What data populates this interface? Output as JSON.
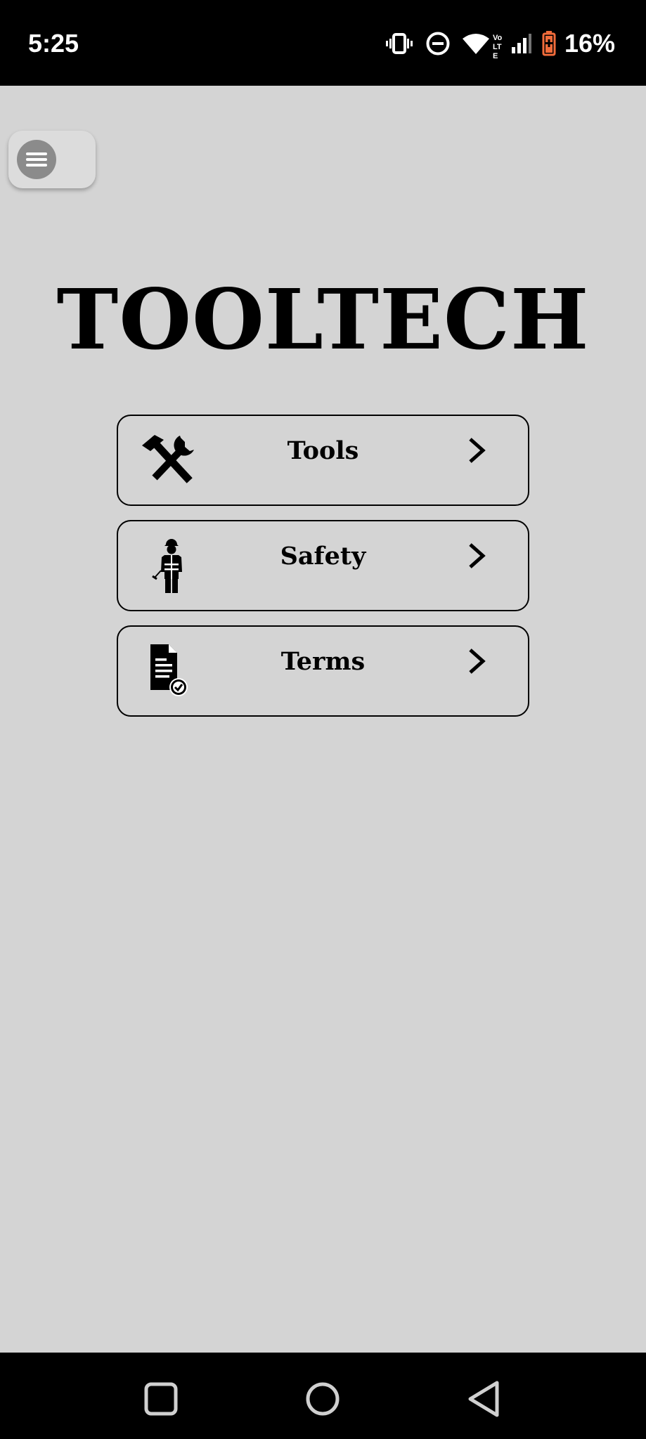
{
  "status_bar": {
    "time": "5:25",
    "battery_percent": "16%",
    "network_label": "Vo LTE",
    "icons": [
      "vibrate-icon",
      "do-not-disturb-icon",
      "wifi-icon",
      "volte-icon",
      "signal-icon",
      "battery-low-icon"
    ],
    "battery_color": "#f26c3b"
  },
  "app": {
    "title": "TOOLTECH",
    "menu_icon": "hamburger-menu-icon"
  },
  "menu": {
    "items": [
      {
        "label": "Tools",
        "icon": "hammer-wrench-icon"
      },
      {
        "label": "Safety",
        "icon": "safety-worker-icon"
      },
      {
        "label": "Terms",
        "icon": "document-check-icon"
      }
    ]
  },
  "navigation_bar": {
    "buttons": [
      "recents-button",
      "home-button",
      "back-button"
    ]
  },
  "colors": {
    "background": "#d4d4d4",
    "bars": "#000000",
    "text": "#000000",
    "menu_button": "#8b8b8b"
  }
}
